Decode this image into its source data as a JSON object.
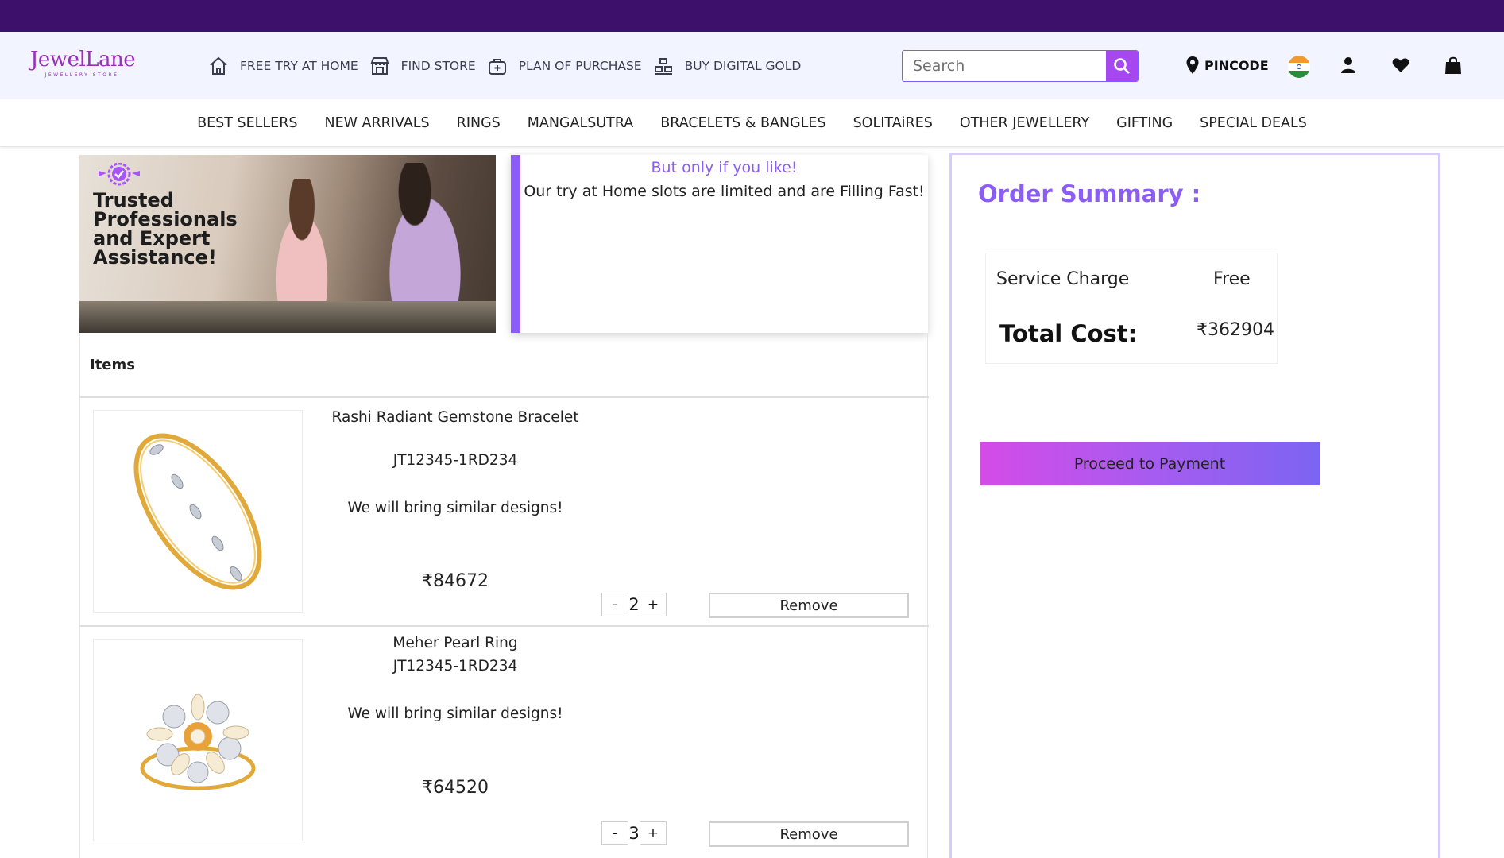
{
  "header": {
    "logo_name": "JewelLane",
    "logo_tag": "JEWELLERY STORE",
    "nav": [
      {
        "label": "FREE TRY AT HOME",
        "icon": "home-icon"
      },
      {
        "label": "FIND STORE",
        "icon": "store-icon"
      },
      {
        "label": "PLAN OF PURCHASE",
        "icon": "plan-bag-icon"
      },
      {
        "label": "BUY DIGITAL GOLD",
        "icon": "gold-bars-icon"
      }
    ],
    "search_placeholder": "Search",
    "pincode_label": "PINCODE",
    "accent_color": "#a548f0",
    "topbar_color": "#3d116b"
  },
  "categories": [
    "BEST SELLERS",
    "NEW ARRIVALS",
    "RINGS",
    "MANGALSUTRA",
    "BRACELETS & BANGLES",
    "SOLITAiRES",
    "OTHER JEWELLERY",
    "GIFTING",
    "SPECIAL DEALS"
  ],
  "banner": {
    "text": "Trusted Professionals and Expert Assistance!"
  },
  "notice": {
    "line1": "But only if you like!",
    "line2": "Our try at Home slots are limited and are Filling Fast!"
  },
  "items_heading": "Items",
  "items": [
    {
      "name": "Rashi Radiant Gemstone Bracelet",
      "code": "JT12345-1RD234",
      "note": "We will bring similar designs!",
      "price": "₹84672",
      "quantity": "2",
      "minus": "-",
      "plus": "+",
      "remove": "Remove"
    },
    {
      "name": "Meher Pearl Ring",
      "code": "JT12345-1RD234",
      "note": "We will bring similar designs!",
      "price": "₹64520",
      "quantity": "3",
      "minus": "-",
      "plus": "+",
      "remove": "Remove"
    }
  ],
  "summary": {
    "title": "Order Summary :",
    "service_charge_label": "Service Charge",
    "service_charge_value": "Free",
    "total_label": "Total Cost:",
    "total_value": "₹362904",
    "proceed_label": "Proceed to Payment"
  }
}
